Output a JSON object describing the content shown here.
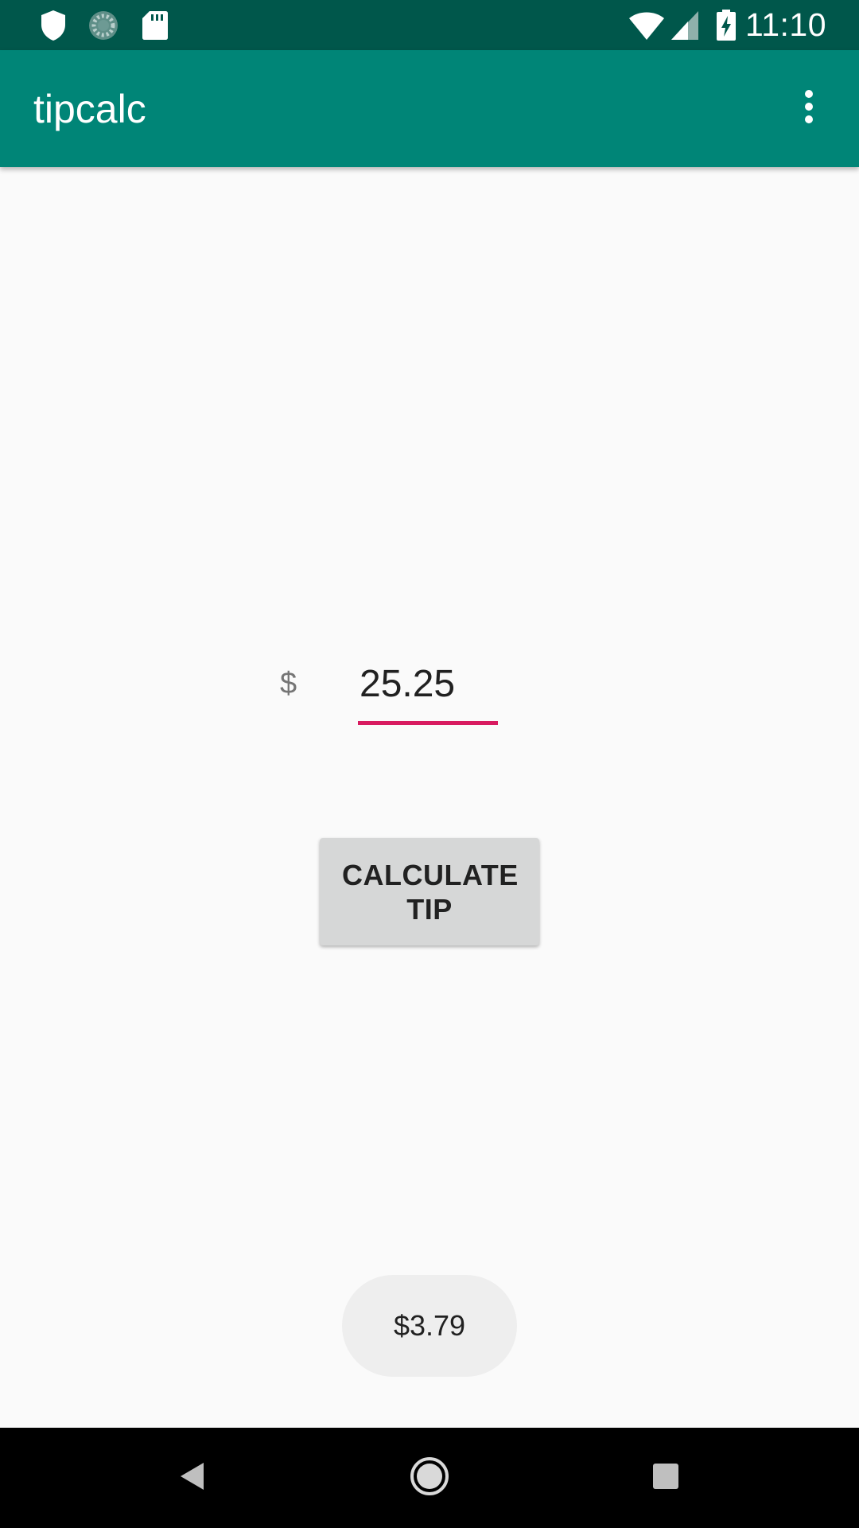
{
  "status_bar": {
    "time": "11:10",
    "left_icons": [
      "shield-icon",
      "sync-icon",
      "sd-card-icon"
    ],
    "right_icons": [
      "wifi-icon",
      "signal-icon",
      "battery-charging-icon"
    ]
  },
  "app_bar": {
    "title": "tipcalc",
    "menu_icon": "more-vert-icon"
  },
  "form": {
    "currency_symbol": "$",
    "amount_value": "25.25"
  },
  "calculate_button": {
    "label": "CALCULATE TIP"
  },
  "toast": {
    "text": "$3.79"
  },
  "nav_bar": {
    "icons": [
      "back-icon",
      "home-icon",
      "recents-icon"
    ]
  },
  "colors": {
    "status_bar": "#00574b",
    "primary": "#008577",
    "accent": "#d81b60",
    "background": "#fafafa",
    "button": "#d6d7d7",
    "toast": "#eeeeee",
    "nav_bar": "#000000"
  }
}
